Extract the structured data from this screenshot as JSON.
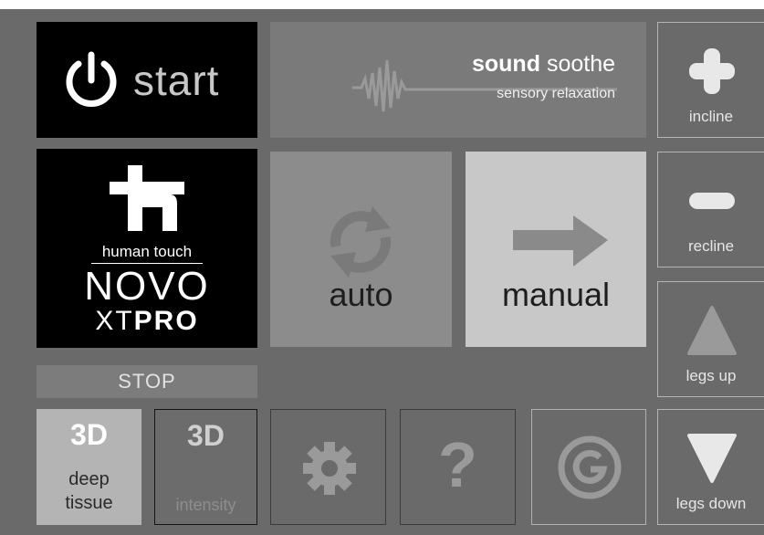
{
  "start": {
    "label": "start",
    "icon": "power-icon"
  },
  "sound": {
    "title_bold": "sound",
    "title_light": "soothe",
    "subtitle": "sensory relaxation",
    "icon": "sound-wave-icon"
  },
  "logo": {
    "brand": "human touch",
    "model_line1": "NOVO",
    "model_line2_prefix": "XT",
    "model_line2_bold": "PRO"
  },
  "modes": {
    "auto": "auto",
    "manual": "manual"
  },
  "stop": {
    "label": "STOP"
  },
  "deep": {
    "badge": "3D",
    "line1": "deep",
    "line2": "tissue"
  },
  "intensity": {
    "badge": "3D",
    "label": "intensity"
  },
  "help": {
    "glyph": "?"
  },
  "right": {
    "incline": "incline",
    "recline": "recline",
    "legs_up": "legs up",
    "legs_down": "legs down"
  },
  "colors": {
    "background": "#6a6a6a",
    "start_bg": "#000000",
    "manual_bg": "#c8c8c8",
    "auto_bg": "#8c8c8c",
    "deep_bg": "#b4b4b4"
  }
}
